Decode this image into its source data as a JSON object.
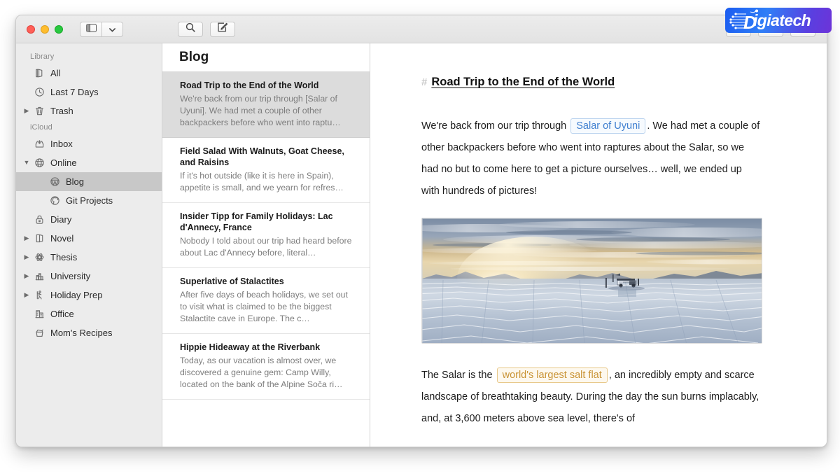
{
  "window": {
    "traffic_lights": [
      "close",
      "minimize",
      "zoom"
    ],
    "colors": {
      "close": "#ff5f57",
      "minimize": "#ffbd2e",
      "zoom": "#28c840",
      "selection_gray": "#c8c8c8",
      "note_selection_gray": "#dcdcdc",
      "sidebar_bg": "#ececec",
      "accent_blue": "#3f7fd0",
      "accent_amber": "#c99334",
      "logo_blue": "#1b5cf0",
      "logo_purple": "#6d33d8"
    }
  },
  "toolbar": {
    "sidebar_toggle_label": "sidebar-toggle",
    "sidebar_dropdown_label": "sidebar-options",
    "search_label": "search",
    "compose_label": "new-note",
    "share_label": "share",
    "dashboard_label": "dashboard"
  },
  "sidebar": {
    "sections": [
      {
        "title": "Library",
        "items": [
          {
            "label": "All",
            "icon": "books-icon",
            "twisty": "none",
            "selected": false,
            "indent": false
          },
          {
            "label": "Last 7 Days",
            "icon": "clock-icon",
            "twisty": "none",
            "selected": false,
            "indent": false
          },
          {
            "label": "Trash",
            "icon": "trash-icon",
            "twisty": "collapsed",
            "selected": false,
            "indent": false
          }
        ]
      },
      {
        "title": "iCloud",
        "items": [
          {
            "label": "Inbox",
            "icon": "inbox-icon",
            "twisty": "none",
            "selected": false,
            "indent": false
          },
          {
            "label": "Online",
            "icon": "globe-icon",
            "twisty": "expanded",
            "selected": false,
            "indent": false
          },
          {
            "label": "Blog",
            "icon": "wordpress-icon",
            "twisty": "none",
            "selected": true,
            "indent": true
          },
          {
            "label": "Git Projects",
            "icon": "github-icon",
            "twisty": "none",
            "selected": false,
            "indent": true
          },
          {
            "label": "Diary",
            "icon": "lock-icon",
            "twisty": "none",
            "selected": false,
            "indent": false
          },
          {
            "label": "Novel",
            "icon": "book-icon",
            "twisty": "collapsed",
            "selected": false,
            "indent": false
          },
          {
            "label": "Thesis",
            "icon": "atom-icon",
            "twisty": "collapsed",
            "selected": false,
            "indent": false
          },
          {
            "label": "University",
            "icon": "campus-icon",
            "twisty": "collapsed",
            "selected": false,
            "indent": false
          },
          {
            "label": "Holiday Prep",
            "icon": "hiker-icon",
            "twisty": "collapsed",
            "selected": false,
            "indent": false
          },
          {
            "label": "Office",
            "icon": "building-icon",
            "twisty": "none",
            "selected": false,
            "indent": false
          },
          {
            "label": "Mom's Recipes",
            "icon": "pot-icon",
            "twisty": "none",
            "selected": false,
            "indent": false
          }
        ]
      }
    ]
  },
  "notelist": {
    "title": "Blog",
    "items": [
      {
        "title": "Road Trip to the End of the World",
        "preview": "We're back from our trip through [Salar of Uyuni]. We had met a couple of other backpackers before who went into raptu…",
        "selected": true
      },
      {
        "title": "Field Salad With Walnuts, Goat Cheese, and Raisins",
        "preview": "If it's hot outside (like it is here in Spain), appetite is small, and we yearn for refres…",
        "selected": false
      },
      {
        "title": "Insider Tipp for Family Holidays: Lac d'Annecy, France",
        "preview": "Nobody I told about our trip had heard before about Lac d'Annecy before, literal…",
        "selected": false
      },
      {
        "title": "Superlative of Stalactites",
        "preview": "After five days of beach holidays, we set out to visit what is claimed to be the biggest Stalactite cave in Europe. The c…",
        "selected": false
      },
      {
        "title": "Hippie Hideaway at the Riverbank",
        "preview": "Today, as our vacation is almost over, we discovered a genuine gem: Camp Willy, located on the bank of the Alpine Soča ri…",
        "selected": false
      }
    ]
  },
  "editor": {
    "hash_marker": "#",
    "doc_title": "Road Trip to the End of the World",
    "paragraph_1": {
      "before": "We're back from our trip through",
      "token": "Salar of Uyuni",
      "after": ". We had met a couple of other backpackers before who went into raptures about the Salar, so we had no but to come here to get a picture ourselves… well, we ended up with hundreds of pictures!"
    },
    "figure_alt": "Salt flat at sunset with 4x4 vehicle",
    "paragraph_2": {
      "before": "The Salar is the",
      "token": "world's largest salt flat",
      "after": ", an incredibly empty and scarce landscape of breathtaking beauty. During the day the sun burns implacably, and, at 3,600 meters above sea level, there's of"
    }
  },
  "watermark": {
    "text": "igiatech",
    "initial": "D"
  }
}
